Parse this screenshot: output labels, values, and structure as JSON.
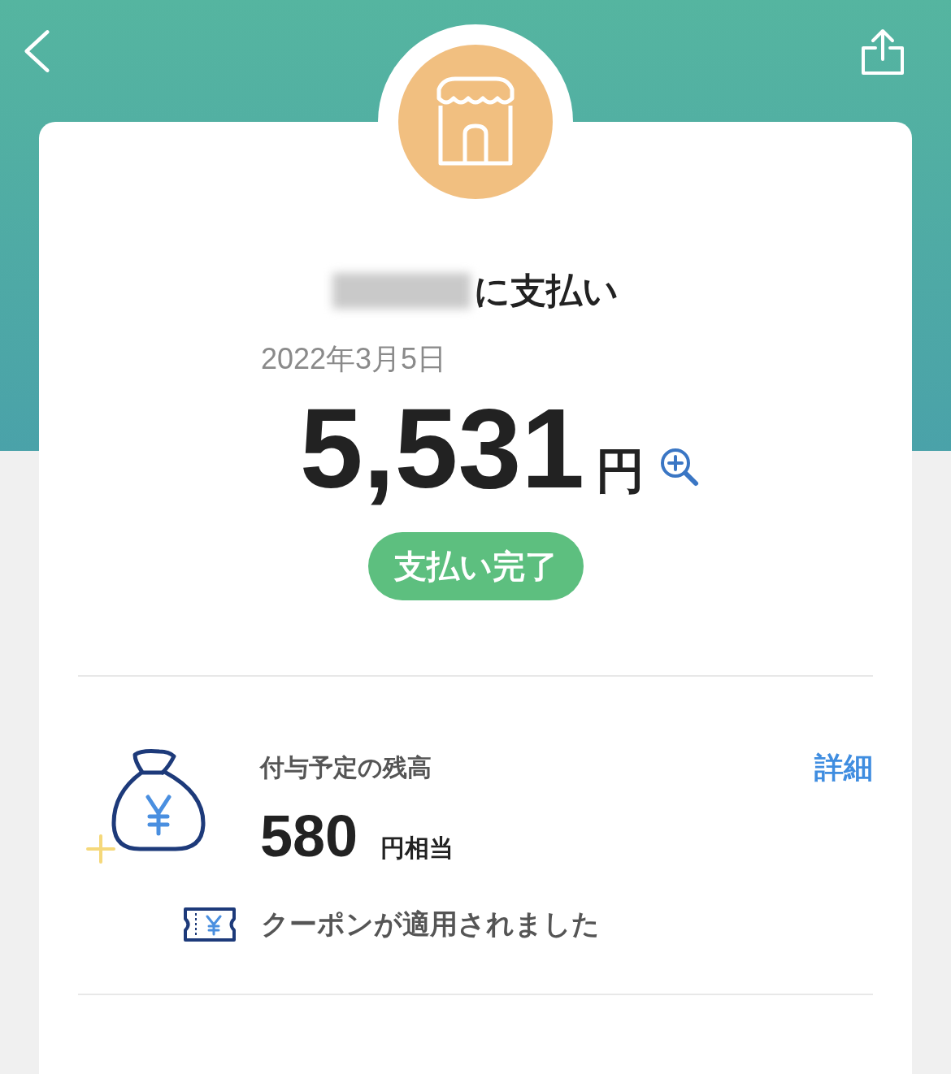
{
  "merchant": {
    "title_suffix": "に支払い",
    "date": "2022年3月5日"
  },
  "amount": {
    "value": "5,531",
    "unit": "円"
  },
  "status": {
    "label": "支払い完了"
  },
  "reward": {
    "label": "付与予定の残高",
    "detail_link": "詳細",
    "value": "580",
    "unit": "円相当"
  },
  "coupon": {
    "text": "クーポンが適用されました"
  }
}
